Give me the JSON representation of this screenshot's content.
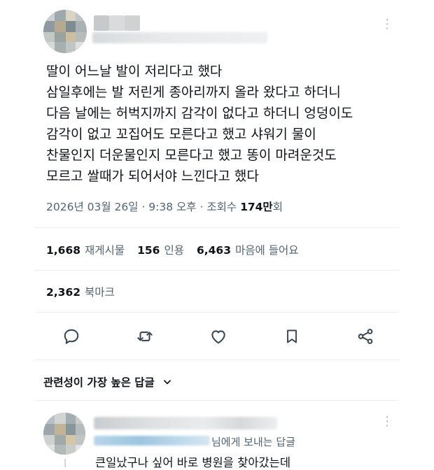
{
  "post": {
    "body_lines": [
      "딸이 어느날 발이 저리다고 했다",
      "삼일후에는 발 저린게 종아리까지 올라 왔다고 하더니",
      "다음 날에는 허벅지까지 감각이 없다고 하더니 엉덩이도",
      "감각이 없고 꼬집어도 모른다고 했고 샤워기 물이",
      "찬물인지 더운물인지 모른다고 했고 똥이 마려운것도",
      "모르고 쌀때가 되어서야 느낀다고 했다"
    ],
    "timestamp": "2026년 03월 26일 · 9:38 오후 · 조회수 ",
    "views_number": "174만",
    "views_unit": "회"
  },
  "stats": {
    "reposts": {
      "number": "1,668",
      "label": "재게시물"
    },
    "quotes": {
      "number": "156",
      "label": "인용"
    },
    "likes": {
      "number": "6,463",
      "label": "마음에 들어요"
    },
    "bookmarks": {
      "number": "2,362",
      "label": "북마크"
    }
  },
  "actions": {
    "icons": [
      "reply-icon",
      "repost-icon",
      "like-icon",
      "bookmark-icon",
      "share-icon"
    ]
  },
  "replies": {
    "sort_label": "관련성이 가장 높은 답글",
    "first_reply": {
      "replying_to": "님에게 보내는 답글",
      "text": "큰일났구나 싶어 바로 병원을 찾아갔는데"
    }
  },
  "colors": {
    "text_primary": "#0f1419",
    "text_secondary": "#536471",
    "divider": "#eceff1",
    "mention_blur": "#7fb3d6"
  }
}
